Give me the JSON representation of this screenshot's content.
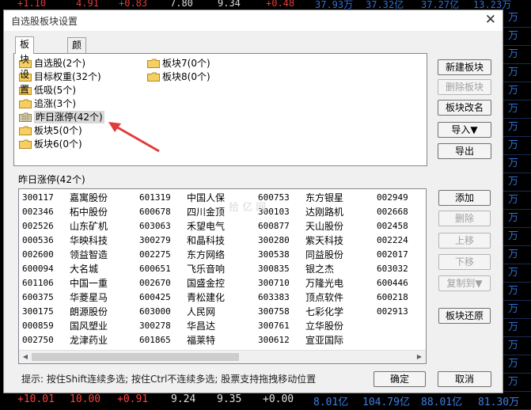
{
  "background": {
    "top_strip": [
      "+1.10",
      "4.91",
      "+0.83",
      "7.80",
      "9.34",
      "+0.48",
      "37.93万",
      "37.32亿",
      "37.27亿",
      "13.23万"
    ],
    "right_strip": [
      "万",
      "万",
      "万",
      "万",
      "万",
      "万",
      "万",
      "万",
      "万",
      "万",
      "万",
      "万",
      "万",
      "万",
      "万",
      "万",
      "万",
      "万",
      "万",
      "万",
      "万",
      "万"
    ],
    "bottom_strip": [
      "+10.01",
      "10.00",
      "+0.91",
      "9.24",
      "9.35",
      "+0.00",
      "8.01亿",
      "104.79亿",
      "88.01亿",
      "81.30万"
    ]
  },
  "dialog": {
    "title": "自选股板块设置",
    "close_glyph": "✕",
    "tabs": [
      "板块设置",
      "颜色设置"
    ],
    "blocks": [
      {
        "label": "自选股(2个)",
        "icon": "folder-icon"
      },
      {
        "label": "目标权重(32个)",
        "icon": "folder-icon"
      },
      {
        "label": "低吸(5个)",
        "icon": "folder-icon"
      },
      {
        "label": "追涨(3个)",
        "icon": "folder-icon"
      },
      {
        "label": "昨日涨停(42个)",
        "icon": "grid-folder-icon",
        "selected": true
      },
      {
        "label": "板块5(0个)",
        "icon": "folder-icon"
      },
      {
        "label": "板块6(0个)",
        "icon": "folder-icon"
      },
      {
        "label": "板块7(0个)",
        "icon": "folder-icon"
      },
      {
        "label": "板块8(0个)",
        "icon": "folder-icon"
      }
    ],
    "side_buttons": [
      {
        "label": "新建板块",
        "enabled": true
      },
      {
        "label": "删除板块",
        "enabled": false
      },
      {
        "label": "板块改名",
        "enabled": true
      },
      {
        "label": "导入▼",
        "enabled": true
      },
      {
        "label": "导出",
        "enabled": true
      }
    ],
    "list_title": "昨日涨停(42个)",
    "stock_columns": [
      [
        [
          "300117",
          "嘉寓股份"
        ],
        [
          "002346",
          "柘中股份"
        ],
        [
          "002526",
          "山东矿机"
        ],
        [
          "000536",
          "华映科技"
        ],
        [
          "002600",
          "领益智造"
        ],
        [
          "600094",
          "大名城"
        ],
        [
          "601106",
          "中国一重"
        ],
        [
          "600375",
          "华菱星马"
        ],
        [
          "300175",
          "朗源股份"
        ],
        [
          "000859",
          "国风塑业"
        ],
        [
          "002750",
          "龙津药业"
        ]
      ],
      [
        [
          "601319",
          "中国人保"
        ],
        [
          "600678",
          "四川金顶"
        ],
        [
          "603063",
          "禾望电气"
        ],
        [
          "300279",
          "和晶科技"
        ],
        [
          "002275",
          "东方网络"
        ],
        [
          "600651",
          "飞乐音响"
        ],
        [
          "002670",
          "国盛金控"
        ],
        [
          "600425",
          "青松建化"
        ],
        [
          "603000",
          "人民网"
        ],
        [
          "300278",
          "华昌达"
        ],
        [
          "601865",
          "福莱特"
        ]
      ],
      [
        [
          "600753",
          "东方银星"
        ],
        [
          "300103",
          "达刚路机"
        ],
        [
          "600877",
          "天山股份"
        ],
        [
          "300280",
          "紫天科技"
        ],
        [
          "300538",
          "同益股份"
        ],
        [
          "300835",
          "银之杰"
        ],
        [
          "300710",
          "万隆光电"
        ],
        [
          "603383",
          "顶点软件"
        ],
        [
          "300758",
          "七彩化学"
        ],
        [
          "300761",
          "立华股份"
        ],
        [
          "300612",
          "宣亚国际"
        ]
      ],
      [
        [
          "002949",
          ""
        ],
        [
          "002668",
          ""
        ],
        [
          "002458",
          ""
        ],
        [
          "002224",
          ""
        ],
        [
          "002017",
          ""
        ],
        [
          "603032",
          ""
        ],
        [
          "600446",
          ""
        ],
        [
          "600218",
          ""
        ],
        [
          "002913",
          ""
        ],
        [
          "",
          ""
        ],
        [
          "",
          ""
        ]
      ]
    ],
    "list_buttons": [
      {
        "label": "添加",
        "enabled": true
      },
      {
        "label": "删除",
        "enabled": false
      },
      {
        "label": "上移",
        "enabled": false
      },
      {
        "label": "下移",
        "enabled": false
      },
      {
        "label": "复制到▼",
        "enabled": false
      },
      {
        "label": "板块还原",
        "enabled": true
      }
    ],
    "watermark": "拾 亿 网",
    "tip": "提示: 按住Shift连续多选; 按住Ctrl不连续多选; 股票支持拖拽移动位置",
    "ok_label": "确定",
    "cancel_label": "取消"
  }
}
